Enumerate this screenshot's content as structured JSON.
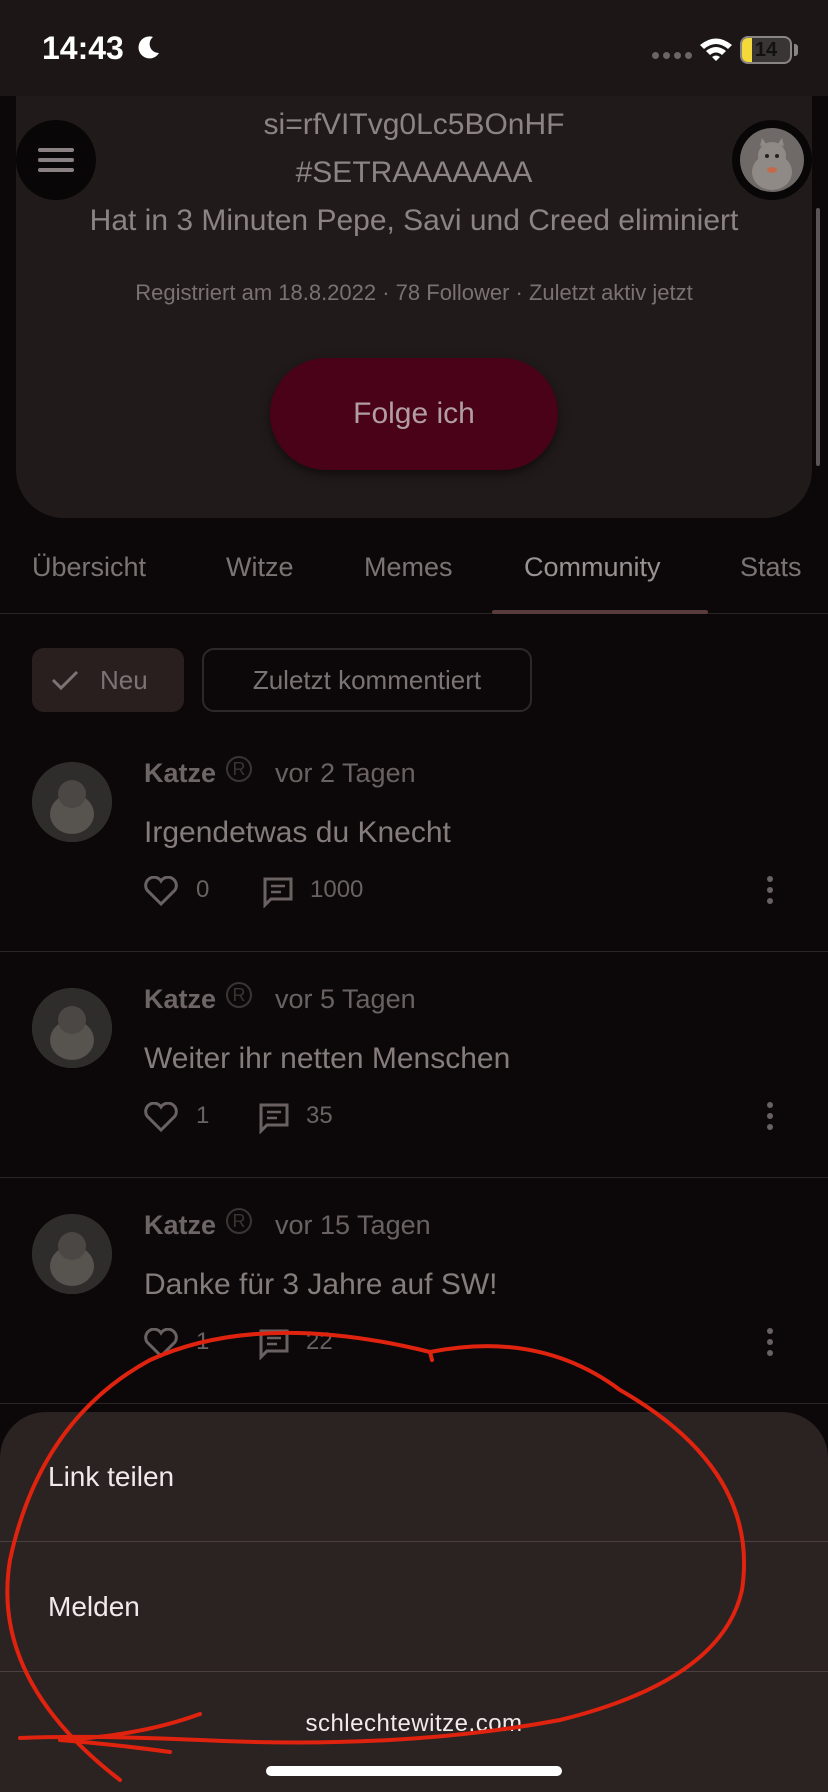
{
  "status_bar": {
    "time": "14:43",
    "battery": "14"
  },
  "profile": {
    "link_text": "si=rfVITvg0Lc5BOnHF",
    "hashtag": "#SETRAAAAAAA",
    "bio": "Hat in 3 Minuten Pepe, Savi und Creed eliminiert",
    "meta": "Registriert am 18.8.2022 · 78 Follower · Zuletzt aktiv jetzt",
    "follow_label": "Folge ich"
  },
  "tabs": [
    {
      "label": "Übersicht"
    },
    {
      "label": "Witze"
    },
    {
      "label": "Memes"
    },
    {
      "label": "Community",
      "active": true
    },
    {
      "label": "Stats"
    }
  ],
  "filters": {
    "neu": "Neu",
    "recent": "Zuletzt kommentiert"
  },
  "posts": [
    {
      "author": "Katze",
      "time": "vor 2 Tagen",
      "text": "Irgendetwas du Knecht",
      "likes": "0",
      "comments": "1000"
    },
    {
      "author": "Katze",
      "time": "vor 5 Tagen",
      "text": "Weiter ihr netten Menschen",
      "likes": "1",
      "comments": "35"
    },
    {
      "author": "Katze",
      "time": "vor 15 Tagen",
      "text": "Danke für 3 Jahre auf SW!",
      "likes": "1",
      "comments": "22"
    }
  ],
  "sheet": {
    "share": "Link teilen",
    "report": "Melden"
  },
  "footer": "schlechtewitze.com",
  "colors": {
    "accent_button": "#4a0218",
    "sheet_bg": "#2b2222",
    "annotation": "#e0230f"
  },
  "icons": [
    "menu-icon",
    "moon-icon",
    "wifi-icon",
    "check-icon",
    "heart-icon",
    "comment-icon",
    "more-vertical-icon"
  ]
}
